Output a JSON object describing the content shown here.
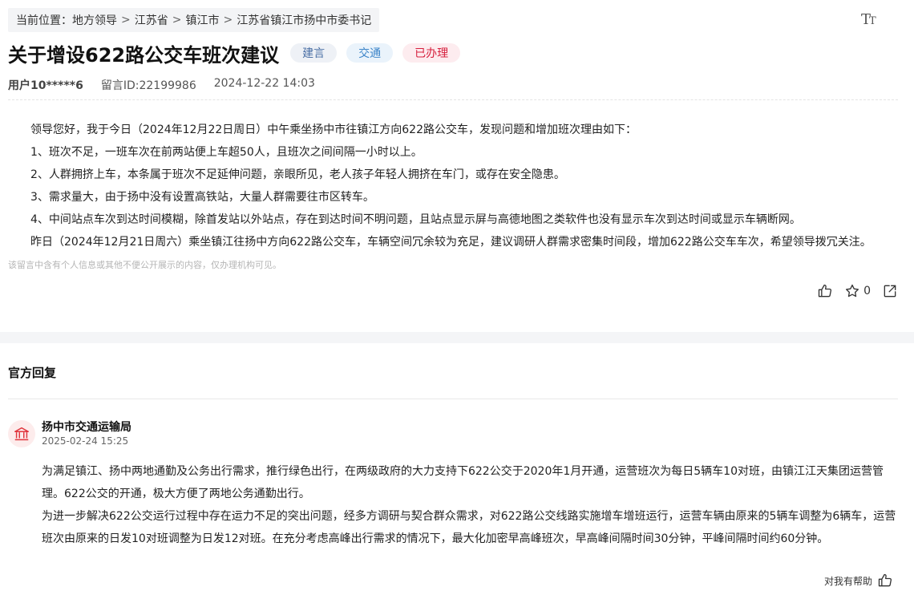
{
  "breadcrumb": {
    "prefix": "当前位置：",
    "items": [
      "地方领导",
      "江苏省",
      "镇江市",
      "江苏省镇江市扬中市委书记"
    ],
    "separator": ">"
  },
  "font_toggle": {
    "big": "T",
    "small": "T"
  },
  "post": {
    "title": "关于增设622路公交车班次建议",
    "tags": [
      "建言",
      "交通",
      "已办理"
    ],
    "user": "用户10*****6",
    "message_id": "留言ID:22199986",
    "datetime": "2024-12-22 14:03",
    "paragraphs": [
      "领导您好，我于今日（2024年12月22日周日）中午乘坐扬中市往镇江方向622路公交车，发现问题和增加班次理由如下：",
      "1、班次不足，一班车次在前两站便上车超50人，且班次之间间隔一小时以上。",
      "2、人群拥挤上车，本条属于班次不足延伸问题，亲眼所见，老人孩子年轻人拥挤在车门，或存在安全隐患。",
      "3、需求量大，由于扬中没有设置高铁站，大量人群需要往市区转车。",
      "4、中间站点车次到达时间模糊，除首发站以外站点，存在到达时间不明问题，且站点显示屏与高德地图之类软件也没有显示车次到达时间或显示车辆断网。",
      "昨日（2024年12月21日周六）乘坐镇江往扬中方向622路公交车，车辆空间冗余较为充足，建议调研人群需求密集时间段，增加622路公交车车次，希望领导拨冗关注。"
    ],
    "privacy_note": "该留言中含有个人信息或其他不便公开展示的内容，仅办理机构可见。",
    "favorite_count": "0"
  },
  "reply": {
    "heading": "官方回复",
    "org_name": "扬中市交通运输局",
    "date": "2025-02-24 15:25",
    "paragraphs": [
      "为满足镇江、扬中两地通勤及公务出行需求，推行绿色出行，在两级政府的大力支持下622公交于2020年1月开通，运营班次为每日5辆车10对班，由镇江江天集团运营管理。622公交的开通，极大方便了两地公务通勤出行。",
      "为进一步解决622公交运行过程中存在运力不足的突出问题，经多方调研与契合群众需求，对622路公交线路实施增车增班运行，运营车辆由原来的5辆车调整为6辆车，运营班次由原来的日发10对班调整为日发12对班。在充分考虑高峰出行需求的情况下，最大化加密早高峰班次，早高峰间隔时间30分钟，平峰间隔时间约60分钟。"
    ],
    "helpful_label": "对我有帮助"
  },
  "colors": {
    "tag_suggest": "#4a6fa5",
    "tag_traffic": "#3c85c9",
    "tag_done": "#d6203e",
    "org_icon": "#e0343c"
  },
  "icons": {
    "like": "thumbs-up-icon",
    "favorite": "star-icon",
    "share": "share-icon",
    "org": "government-building-icon",
    "font_size": "font-size-icon"
  }
}
